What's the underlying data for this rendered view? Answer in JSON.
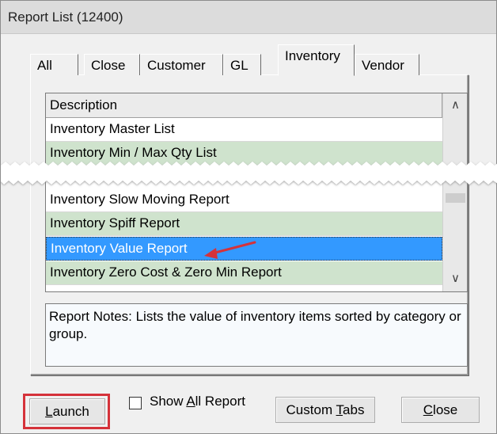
{
  "window": {
    "title": "Report List (12400)"
  },
  "tabs": [
    {
      "label": "All"
    },
    {
      "label": "Close"
    },
    {
      "label": "Customer"
    },
    {
      "label": "GL"
    },
    {
      "label": "Inventory"
    },
    {
      "label": "Vendor"
    }
  ],
  "active_tab": "Inventory",
  "list": {
    "header": "Description",
    "rows": [
      {
        "text": "Inventory Master List",
        "style": "white"
      },
      {
        "text": "Inventory Min / Max Qty List",
        "style": "green"
      },
      {
        "text": "Inventory Slow Moving Report",
        "style": "white"
      },
      {
        "text": "Inventory Spiff Report",
        "style": "green"
      },
      {
        "text": "Inventory Value Report",
        "style": "selected"
      },
      {
        "text": "Inventory Zero Cost & Zero Min Report",
        "style": "green"
      }
    ]
  },
  "notes": {
    "text": "Report Notes:  Lists the value of inventory items sorted by category or group."
  },
  "footer": {
    "launch_pre": "",
    "launch_u": "L",
    "launch_post": "aunch",
    "show_all_pre": "Show ",
    "show_all_u": "A",
    "show_all_post": "ll Report",
    "custom_pre": "Custom ",
    "custom_u": "T",
    "custom_post": "abs",
    "close_pre": "",
    "close_u": "C",
    "close_post": "lose"
  },
  "colors": {
    "selected_row": "#3399ff",
    "alt_row": "#cfe3cd",
    "highlight_outline": "#d5323a",
    "annotation_arrow": "#d5323a"
  },
  "icons": {
    "scroll_up": "chevron-up-icon",
    "scroll_down": "chevron-down-icon",
    "annotation": "arrow-icon"
  }
}
